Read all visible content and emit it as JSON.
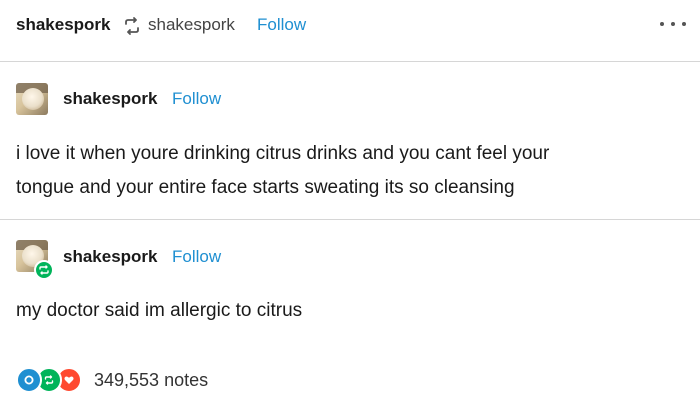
{
  "header": {
    "reblogger": "shakespork",
    "source_user": "shakespork",
    "follow_label": "Follow",
    "reblog_icon": "reblog-icon",
    "more_icon": "more-options-icon"
  },
  "posts": [
    {
      "username": "shakespork",
      "follow_label": "Follow",
      "text_lines": [
        "i love it when youre drinking citrus drinks and you cant feel your",
        "tongue and your entire face starts sweating its so cleansing"
      ]
    },
    {
      "username": "shakespork",
      "follow_label": "Follow",
      "text_lines": [
        "my doctor said im allergic to citrus"
      ]
    }
  ],
  "notes": {
    "count_text": "349,553 notes",
    "icons": [
      "comment-icon",
      "reblog-icon",
      "like-icon"
    ]
  },
  "colors": {
    "follow": "#1f8fd1",
    "reblog_green": "#00b45a",
    "comment_blue": "#1f8fd1",
    "like_red": "#ff4930"
  }
}
